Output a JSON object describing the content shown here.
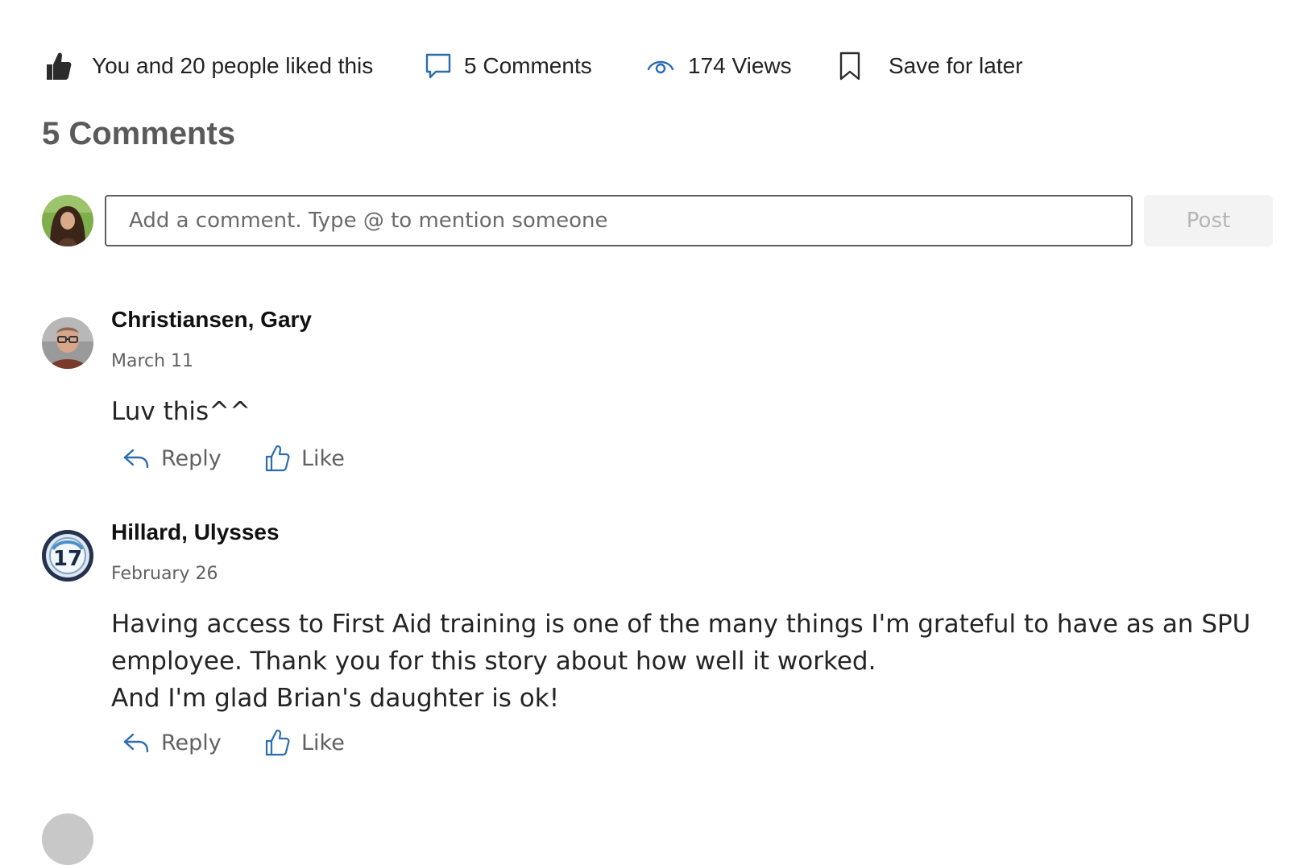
{
  "stats": {
    "likes_text": "You and 20 people liked this",
    "comments_text": "5 Comments",
    "views_text": "174 Views",
    "save_text": "Save for later"
  },
  "section": {
    "title": "5 Comments"
  },
  "composer": {
    "placeholder": "Add a comment. Type @ to mention someone",
    "post_label": "Post"
  },
  "comments": [
    {
      "author": "Christiansen, Gary",
      "date": "March 11",
      "body": "Luv this^^",
      "reply_label": "Reply",
      "like_label": "Like"
    },
    {
      "author": "Hillard, Ulysses",
      "date": "February 26",
      "body": "Having access to First Aid training is one of the many things I'm grateful to have as an SPU employee. Thank you for this story about how well it worked.\nAnd I'm glad Brian's daughter is ok!",
      "avatar_badge": "17",
      "reply_label": "Reply",
      "like_label": "Like"
    }
  ],
  "icons": {
    "like_filled": "thumbs-up-filled-icon",
    "comment": "speech-bubble-icon",
    "views": "eye-icon",
    "save": "bookmark-icon",
    "reply": "reply-arrow-icon",
    "like_outline": "thumbs-up-outline-icon"
  },
  "colors": {
    "accent": "#2b6cb0",
    "muted_text": "#616161",
    "post_disabled_bg": "#f3f3f3"
  }
}
